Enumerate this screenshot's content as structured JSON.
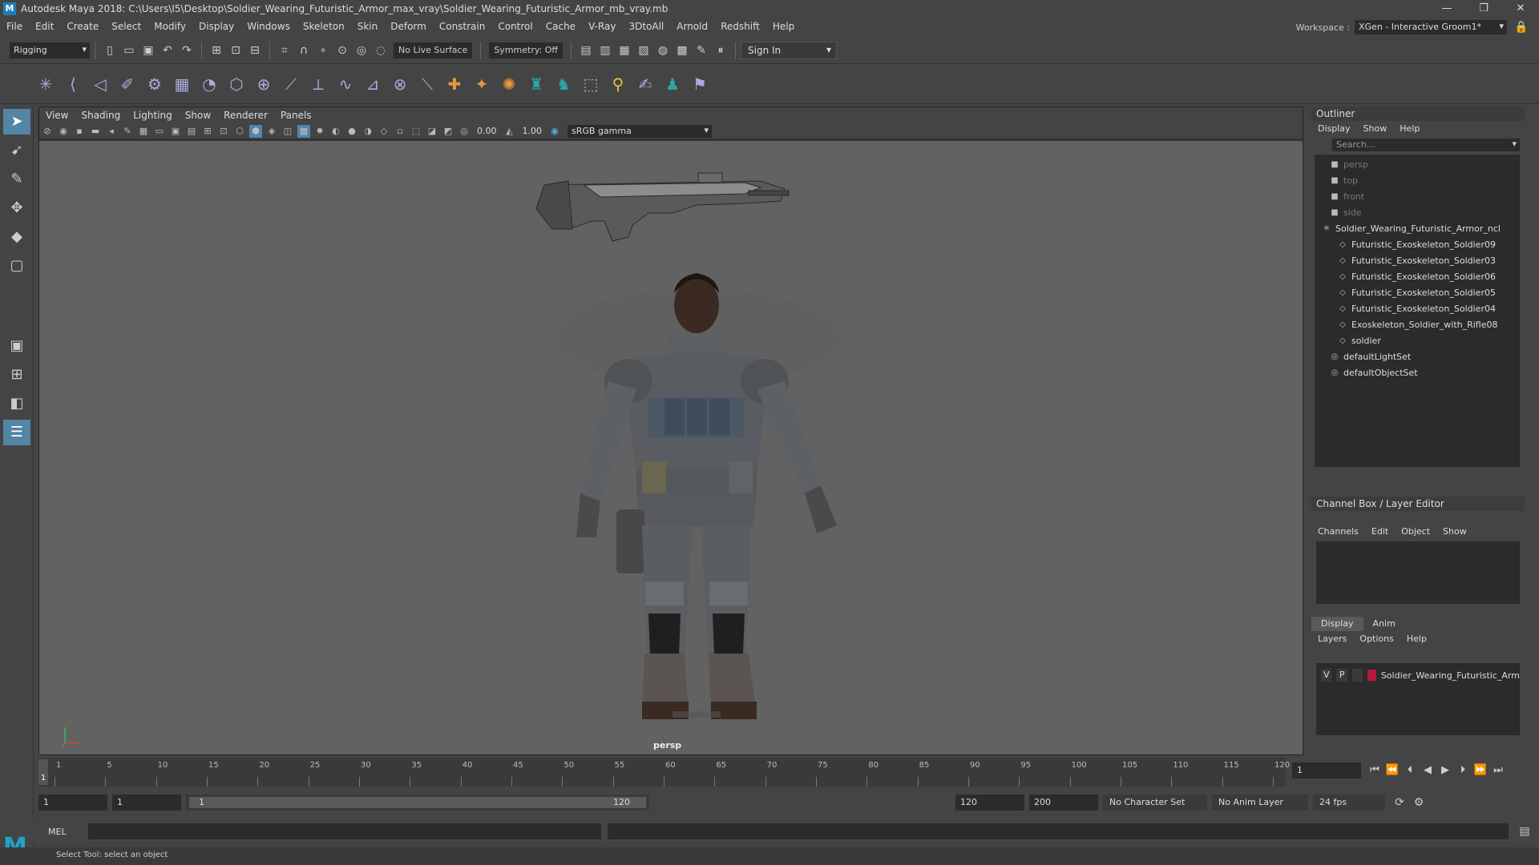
{
  "window": {
    "title": "Autodesk Maya 2018: C:\\Users\\I5\\Desktop\\Soldier_Wearing_Futuristic_Armor_max_vray\\Soldier_Wearing_Futuristic_Armor_mb_vray.mb",
    "min": "—",
    "max": "❐",
    "close": "✕"
  },
  "menu": [
    "File",
    "Edit",
    "Create",
    "Select",
    "Modify",
    "Display",
    "Windows",
    "Skeleton",
    "Skin",
    "Deform",
    "Constrain",
    "Control",
    "Cache",
    "V-Ray",
    "3DtoAll",
    "Arnold",
    "Redshift",
    "Help"
  ],
  "workspace": {
    "label": "Workspace :",
    "value": "XGen - Interactive Groom1*"
  },
  "statusline": {
    "mode": "Rigging",
    "live_surface": "No Live Surface",
    "symmetry": "Symmetry: Off",
    "sign_in": "Sign In"
  },
  "viewport": {
    "menu": [
      "View",
      "Shading",
      "Lighting",
      "Show",
      "Renderer",
      "Panels"
    ],
    "exposure": "0.00",
    "gamma_val": "1.00",
    "color_space": "sRGB gamma",
    "camera": "persp"
  },
  "outliner": {
    "title": "Outliner",
    "menu": [
      "Display",
      "Show",
      "Help"
    ],
    "search_placeholder": "Search...",
    "items": [
      {
        "label": "persp",
        "dim": true,
        "indent": 1,
        "icon": "camera-icon"
      },
      {
        "label": "top",
        "dim": true,
        "indent": 1,
        "icon": "camera-icon"
      },
      {
        "label": "front",
        "dim": true,
        "indent": 1,
        "icon": "camera-icon"
      },
      {
        "label": "side",
        "dim": true,
        "indent": 1,
        "icon": "camera-icon"
      },
      {
        "label": "Soldier_Wearing_Futuristic_Armor_ncl",
        "dim": false,
        "indent": 0,
        "icon": "joint-icon"
      },
      {
        "label": "Futuristic_Exoskeleton_Soldier09",
        "dim": false,
        "indent": 2,
        "icon": "mesh-icon"
      },
      {
        "label": "Futuristic_Exoskeleton_Soldier03",
        "dim": false,
        "indent": 2,
        "icon": "mesh-icon"
      },
      {
        "label": "Futuristic_Exoskeleton_Soldier06",
        "dim": false,
        "indent": 2,
        "icon": "mesh-icon"
      },
      {
        "label": "Futuristic_Exoskeleton_Soldier05",
        "dim": false,
        "indent": 2,
        "icon": "mesh-icon"
      },
      {
        "label": "Futuristic_Exoskeleton_Soldier04",
        "dim": false,
        "indent": 2,
        "icon": "mesh-icon"
      },
      {
        "label": "Exoskeleton_Soldier_with_Rifle08",
        "dim": false,
        "indent": 2,
        "icon": "mesh-icon"
      },
      {
        "label": "soldier",
        "dim": false,
        "indent": 2,
        "icon": "mesh-icon"
      },
      {
        "label": "defaultLightSet",
        "dim": false,
        "indent": 1,
        "icon": "set-icon"
      },
      {
        "label": "defaultObjectSet",
        "dim": false,
        "indent": 1,
        "icon": "set-icon"
      }
    ]
  },
  "channelbox": {
    "title": "Channel Box / Layer Editor",
    "menu": [
      "Channels",
      "Edit",
      "Object",
      "Show"
    ]
  },
  "layers": {
    "tabs": [
      "Display",
      "Anim"
    ],
    "menu": [
      "Layers",
      "Options",
      "Help"
    ],
    "row": {
      "v": "V",
      "p": "P",
      "name": "Soldier_Wearing_Futuristic_Arm",
      "color": "#b5193f"
    }
  },
  "timeline": {
    "ticks": [
      "1",
      "5",
      "10",
      "15",
      "20",
      "25",
      "30",
      "35",
      "40",
      "45",
      "50",
      "55",
      "60",
      "65",
      "70",
      "75",
      "80",
      "85",
      "90",
      "95",
      "100",
      "105",
      "110",
      "115",
      "120"
    ],
    "current": "1",
    "frame_field": "1"
  },
  "range": {
    "start": "1",
    "start2": "1",
    "slider_start": "1",
    "slider_end": "120",
    "end": "120",
    "end2": "200",
    "char_set": "No Character Set",
    "anim_layer": "No Anim Layer",
    "fps": "24 fps"
  },
  "cmd": {
    "label": "MEL"
  },
  "help": "Select Tool: select an object"
}
